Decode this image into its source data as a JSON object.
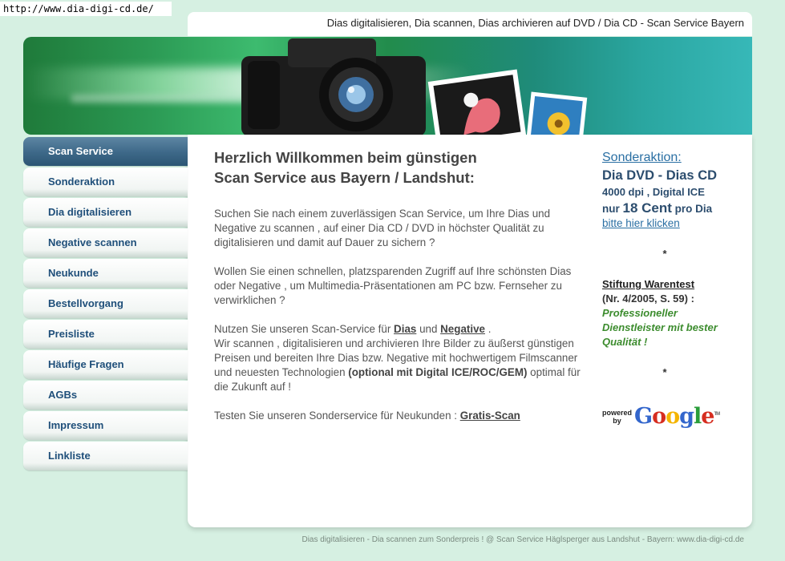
{
  "url": "http://www.dia-digi-cd.de/",
  "top_title": "Dias digitalisieren, Dia scannen, Dias archivieren auf DVD / Dia CD - Scan Service Bayern",
  "nav": {
    "items": [
      {
        "label": "Scan Service",
        "active": true
      },
      {
        "label": "Sonderaktion"
      },
      {
        "label": "Dia digitalisieren"
      },
      {
        "label": "Negative scannen"
      },
      {
        "label": "Neukunde"
      },
      {
        "label": "Bestellvorgang"
      },
      {
        "label": "Preisliste"
      },
      {
        "label": "Häufige Fragen"
      },
      {
        "label": "AGBs"
      },
      {
        "label": "Impressum"
      },
      {
        "label": "Linkliste"
      }
    ]
  },
  "content": {
    "heading_line1": "Herzlich Willkommen beim günstigen",
    "heading_line2": "Scan Service aus Bayern / Landshut:",
    "p1": "Suchen Sie nach einem zuverlässigen Scan Service, um Ihre Dias und Negative zu scannen , auf einer Dia CD / DVD in höchster Qualität zu digitalisieren und damit auf Dauer zu sichern ?",
    "p2": "Wollen Sie einen schnellen, platzsparenden Zugriff  auf Ihre schönsten Dias oder Negative , um Multimedia-Präsentationen am PC bzw. Fernseher zu verwirklichen ?",
    "p3_pre": "Nutzen Sie unseren Scan-Service für ",
    "p3_link_dias": "Dias",
    "p3_und": " und ",
    "p3_link_negative": "Negative",
    "p3_post": " .",
    "p3_body": "Wir scannen , digitalisieren und archivieren Ihre Bilder zu äußerst günstigen Preisen und bereiten Ihre Dias bzw. Negative mit hochwertigem Filmscanner und neuesten Technologien ",
    "p3_bold": "(optional mit Digital ICE/ROC/GEM)",
    "p3_end": " optimal für die Zukunft auf !",
    "p4_pre": "Testen Sie unseren Sonderservice für Neukunden : ",
    "p4_link": "Gratis-Scan"
  },
  "side": {
    "sonderaktion_title": "Sonderaktion:",
    "dvd_line": "Dia DVD - Dias CD",
    "dpi_line": "4000 dpi , Digital ICE",
    "price_pre": "nur ",
    "price_big": "18 Cent",
    "price_post": " pro Dia",
    "link": "bitte hier klicken",
    "star1": "*",
    "warentest_title": "Stiftung Warentest",
    "warentest_ref": "(Nr. 4/2005, S. 59) :",
    "warentest_quote": "Professioneller Dienstleister mit bester Qualität !",
    "star2": "*"
  },
  "google": {
    "powered": "powered",
    "by": "by",
    "letters": [
      "G",
      "o",
      "o",
      "g",
      "l",
      "e"
    ],
    "colors": [
      "#3366cc",
      "#d62d20",
      "#f4b400",
      "#3366cc",
      "#2a9d3a",
      "#d62d20"
    ],
    "tm": "TM"
  },
  "footer": "Dias digitalisieren - Dia scannen zum Sonderpreis ! @ Scan Service Häglsperger aus Landshut - Bayern: www.dia-digi-cd.de"
}
